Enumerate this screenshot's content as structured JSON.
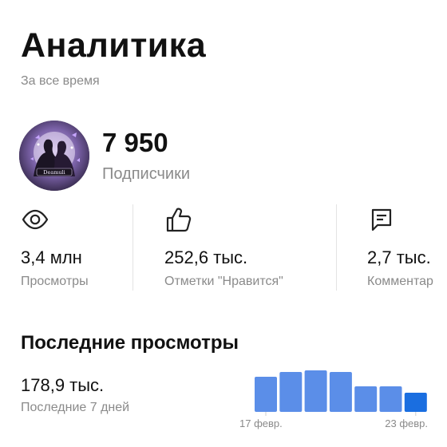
{
  "header": {
    "title": "Аналитика",
    "period": "За все время"
  },
  "channel": {
    "avatar_label": "Deamuli",
    "subscribers_count": "7 950",
    "subscribers_label": "Подписчики"
  },
  "stats": [
    {
      "icon": "eye-icon",
      "value": "3,4 млн",
      "label": "Просмотры"
    },
    {
      "icon": "thumbs-up-icon",
      "value": "252,6 тыс.",
      "label": "Отметки \"Нравится\""
    },
    {
      "icon": "comment-icon",
      "value": "2,7 тыс.",
      "label": "Комментар"
    }
  ],
  "recent_views": {
    "title": "Последние просмотры",
    "value": "178,9 тыс.",
    "label": "Последние 7 дней"
  },
  "chart_data": {
    "type": "bar",
    "categories": [
      "17 февр.",
      "",
      "",
      "",
      "",
      "",
      "23 февр."
    ],
    "x_tick_labels": [
      "17 февр.",
      "23 февр."
    ],
    "values": [
      1.0,
      1.12,
      1.17,
      1.13,
      0.71,
      0.72,
      0.55
    ],
    "units": "relative",
    "colors": {
      "bar": "#5b8ee8",
      "last_bar": "#1a6ee0"
    }
  }
}
